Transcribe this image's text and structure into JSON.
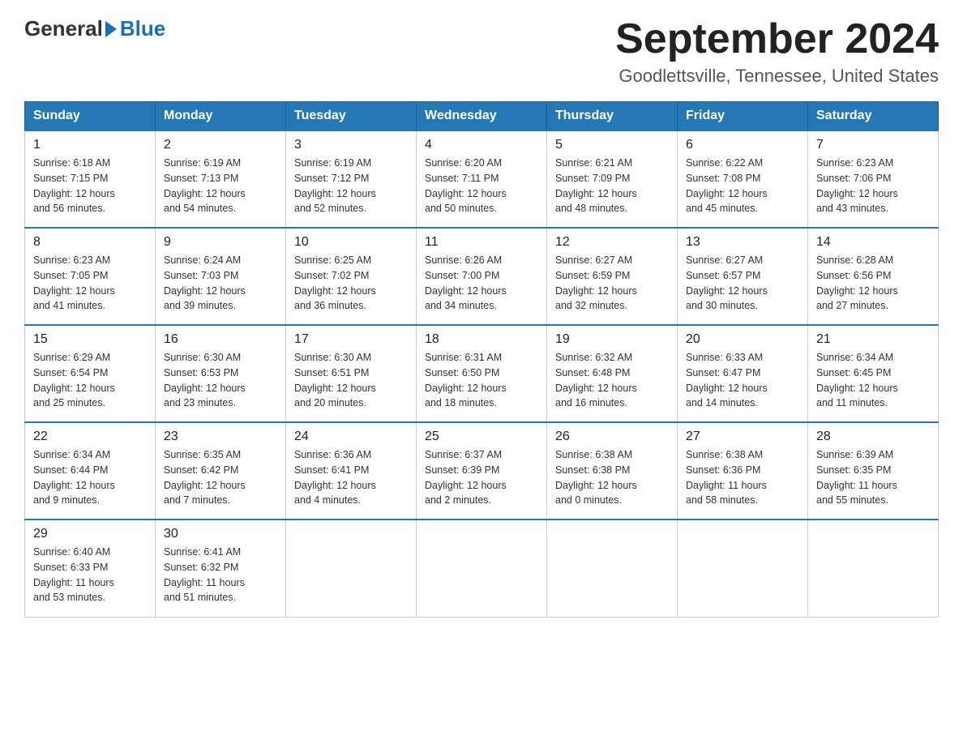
{
  "header": {
    "logo_general": "General",
    "logo_blue": "Blue",
    "month_title": "September 2024",
    "location": "Goodlettsville, Tennessee, United States"
  },
  "weekdays": [
    "Sunday",
    "Monday",
    "Tuesday",
    "Wednesday",
    "Thursday",
    "Friday",
    "Saturday"
  ],
  "weeks": [
    [
      {
        "day": "1",
        "sunrise": "6:18 AM",
        "sunset": "7:15 PM",
        "daylight": "12 hours and 56 minutes."
      },
      {
        "day": "2",
        "sunrise": "6:19 AM",
        "sunset": "7:13 PM",
        "daylight": "12 hours and 54 minutes."
      },
      {
        "day": "3",
        "sunrise": "6:19 AM",
        "sunset": "7:12 PM",
        "daylight": "12 hours and 52 minutes."
      },
      {
        "day": "4",
        "sunrise": "6:20 AM",
        "sunset": "7:11 PM",
        "daylight": "12 hours and 50 minutes."
      },
      {
        "day": "5",
        "sunrise": "6:21 AM",
        "sunset": "7:09 PM",
        "daylight": "12 hours and 48 minutes."
      },
      {
        "day": "6",
        "sunrise": "6:22 AM",
        "sunset": "7:08 PM",
        "daylight": "12 hours and 45 minutes."
      },
      {
        "day": "7",
        "sunrise": "6:23 AM",
        "sunset": "7:06 PM",
        "daylight": "12 hours and 43 minutes."
      }
    ],
    [
      {
        "day": "8",
        "sunrise": "6:23 AM",
        "sunset": "7:05 PM",
        "daylight": "12 hours and 41 minutes."
      },
      {
        "day": "9",
        "sunrise": "6:24 AM",
        "sunset": "7:03 PM",
        "daylight": "12 hours and 39 minutes."
      },
      {
        "day": "10",
        "sunrise": "6:25 AM",
        "sunset": "7:02 PM",
        "daylight": "12 hours and 36 minutes."
      },
      {
        "day": "11",
        "sunrise": "6:26 AM",
        "sunset": "7:00 PM",
        "daylight": "12 hours and 34 minutes."
      },
      {
        "day": "12",
        "sunrise": "6:27 AM",
        "sunset": "6:59 PM",
        "daylight": "12 hours and 32 minutes."
      },
      {
        "day": "13",
        "sunrise": "6:27 AM",
        "sunset": "6:57 PM",
        "daylight": "12 hours and 30 minutes."
      },
      {
        "day": "14",
        "sunrise": "6:28 AM",
        "sunset": "6:56 PM",
        "daylight": "12 hours and 27 minutes."
      }
    ],
    [
      {
        "day": "15",
        "sunrise": "6:29 AM",
        "sunset": "6:54 PM",
        "daylight": "12 hours and 25 minutes."
      },
      {
        "day": "16",
        "sunrise": "6:30 AM",
        "sunset": "6:53 PM",
        "daylight": "12 hours and 23 minutes."
      },
      {
        "day": "17",
        "sunrise": "6:30 AM",
        "sunset": "6:51 PM",
        "daylight": "12 hours and 20 minutes."
      },
      {
        "day": "18",
        "sunrise": "6:31 AM",
        "sunset": "6:50 PM",
        "daylight": "12 hours and 18 minutes."
      },
      {
        "day": "19",
        "sunrise": "6:32 AM",
        "sunset": "6:48 PM",
        "daylight": "12 hours and 16 minutes."
      },
      {
        "day": "20",
        "sunrise": "6:33 AM",
        "sunset": "6:47 PM",
        "daylight": "12 hours and 14 minutes."
      },
      {
        "day": "21",
        "sunrise": "6:34 AM",
        "sunset": "6:45 PM",
        "daylight": "12 hours and 11 minutes."
      }
    ],
    [
      {
        "day": "22",
        "sunrise": "6:34 AM",
        "sunset": "6:44 PM",
        "daylight": "12 hours and 9 minutes."
      },
      {
        "day": "23",
        "sunrise": "6:35 AM",
        "sunset": "6:42 PM",
        "daylight": "12 hours and 7 minutes."
      },
      {
        "day": "24",
        "sunrise": "6:36 AM",
        "sunset": "6:41 PM",
        "daylight": "12 hours and 4 minutes."
      },
      {
        "day": "25",
        "sunrise": "6:37 AM",
        "sunset": "6:39 PM",
        "daylight": "12 hours and 2 minutes."
      },
      {
        "day": "26",
        "sunrise": "6:38 AM",
        "sunset": "6:38 PM",
        "daylight": "12 hours and 0 minutes."
      },
      {
        "day": "27",
        "sunrise": "6:38 AM",
        "sunset": "6:36 PM",
        "daylight": "11 hours and 58 minutes."
      },
      {
        "day": "28",
        "sunrise": "6:39 AM",
        "sunset": "6:35 PM",
        "daylight": "11 hours and 55 minutes."
      }
    ],
    [
      {
        "day": "29",
        "sunrise": "6:40 AM",
        "sunset": "6:33 PM",
        "daylight": "11 hours and 53 minutes."
      },
      {
        "day": "30",
        "sunrise": "6:41 AM",
        "sunset": "6:32 PM",
        "daylight": "11 hours and 51 minutes."
      },
      null,
      null,
      null,
      null,
      null
    ]
  ]
}
